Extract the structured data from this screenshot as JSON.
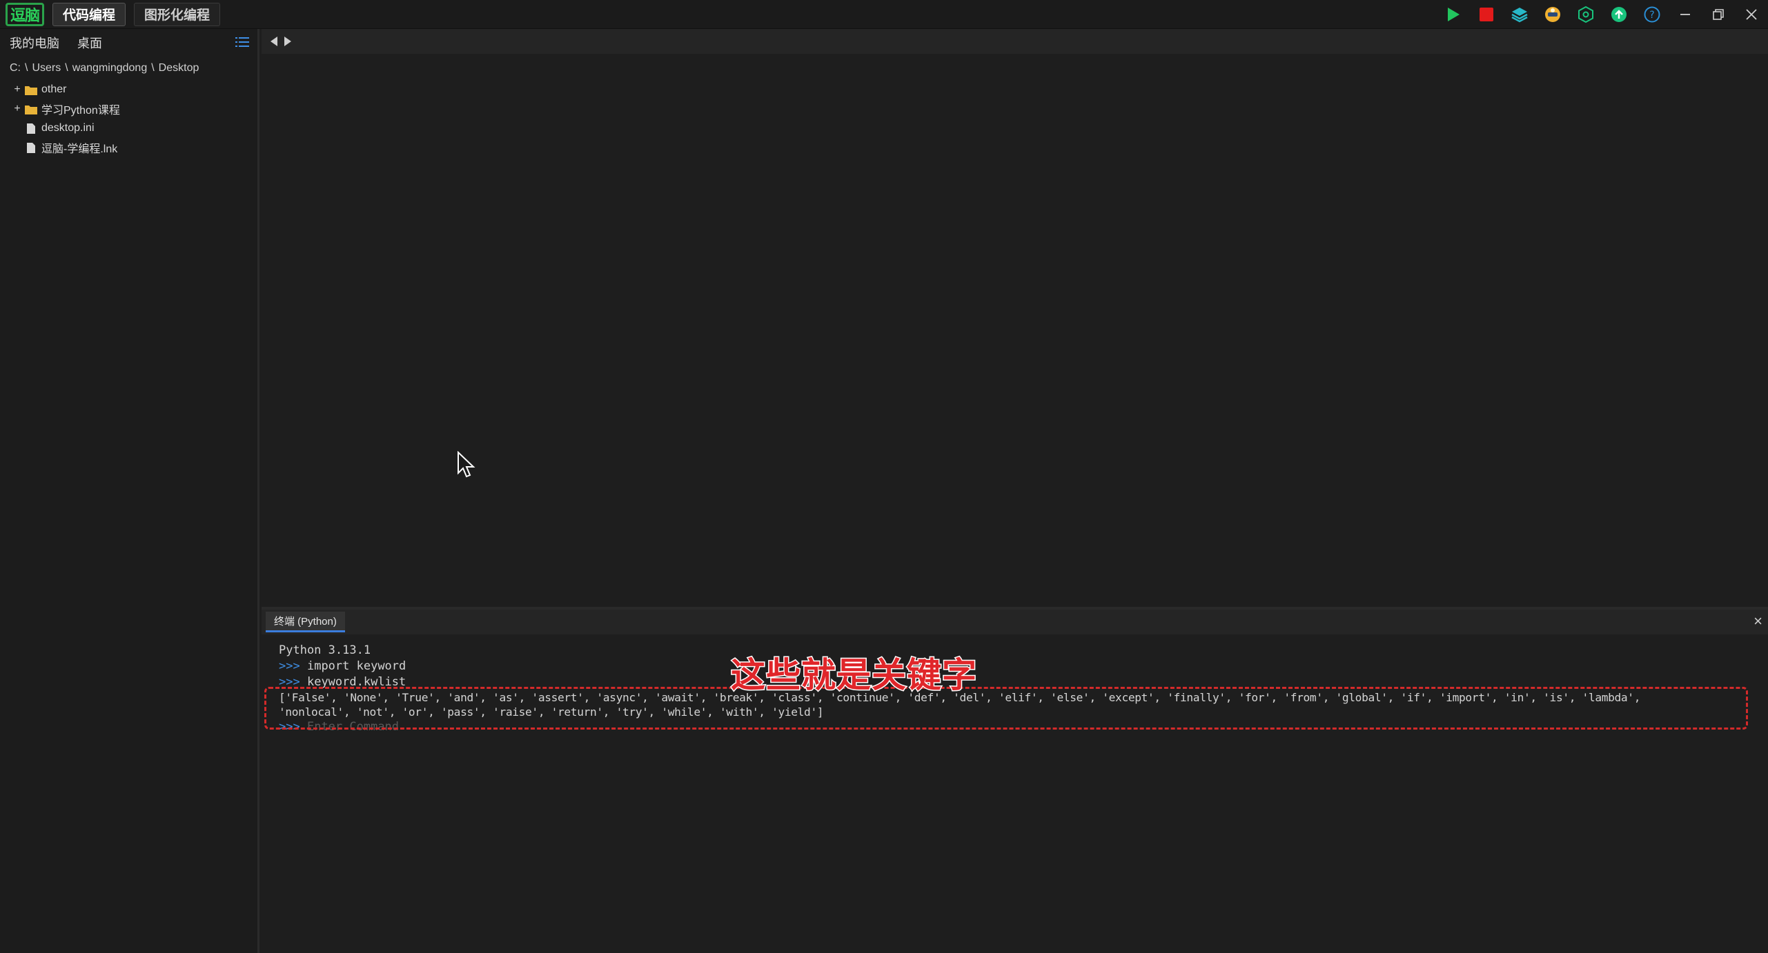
{
  "titlebar": {
    "logo_text": "逗脑",
    "tabs": [
      {
        "label": "代码编程",
        "active": true
      },
      {
        "label": "图形化编程",
        "active": false
      }
    ],
    "actions": [
      {
        "name": "run-icon",
        "color": "#22c55e"
      },
      {
        "name": "stop-icon",
        "color": "#e31b1b"
      },
      {
        "name": "layers-icon",
        "color": "#28b8c8"
      },
      {
        "name": "avatar-icon",
        "color": "#f0b030"
      },
      {
        "name": "settings-hex-icon",
        "color": "#19c37d"
      },
      {
        "name": "upload-icon",
        "color": "#19c37d"
      },
      {
        "name": "help-icon",
        "color": "#2a8fd6"
      },
      {
        "name": "minimize-icon",
        "color": "#cfcfcf"
      },
      {
        "name": "restore-icon",
        "color": "#cfcfcf"
      },
      {
        "name": "close-icon",
        "color": "#cfcfcf"
      }
    ]
  },
  "sidebar": {
    "header": {
      "computer": "我的电脑",
      "desktop": "桌面"
    },
    "path": [
      "C:",
      "Users",
      "wangmingdong",
      "Desktop"
    ],
    "items": [
      {
        "type": "folder",
        "expand": "+",
        "label": "other"
      },
      {
        "type": "folder",
        "expand": "+",
        "label": "学习Python课程"
      },
      {
        "type": "file",
        "expand": "",
        "label": "desktop.ini"
      },
      {
        "type": "file",
        "expand": "",
        "label": "逗脑-学编程.lnk"
      }
    ]
  },
  "terminal": {
    "tab_label": "终端 (Python)",
    "close_label": "×",
    "version_line": "Python 3.13.1",
    "prompt": ">>>",
    "commands": [
      "import keyword",
      "keyword.kwlist"
    ],
    "output_line_1": "['False', 'None', 'True', 'and', 'as', 'assert', 'async', 'await', 'break', 'class', 'continue', 'def', 'del', 'elif', 'else', 'except', 'finally', 'for', 'from', 'global', 'if', 'import', 'in', 'is', 'lambda',",
    "output_line_2": "'nonlocal', 'not', 'or', 'pass', 'raise', 'return', 'try', 'while', 'with', 'yield']",
    "input_placeholder": "Enter Command"
  },
  "annotation": {
    "text": "这些就是关键字",
    "color": "#e0262a"
  }
}
